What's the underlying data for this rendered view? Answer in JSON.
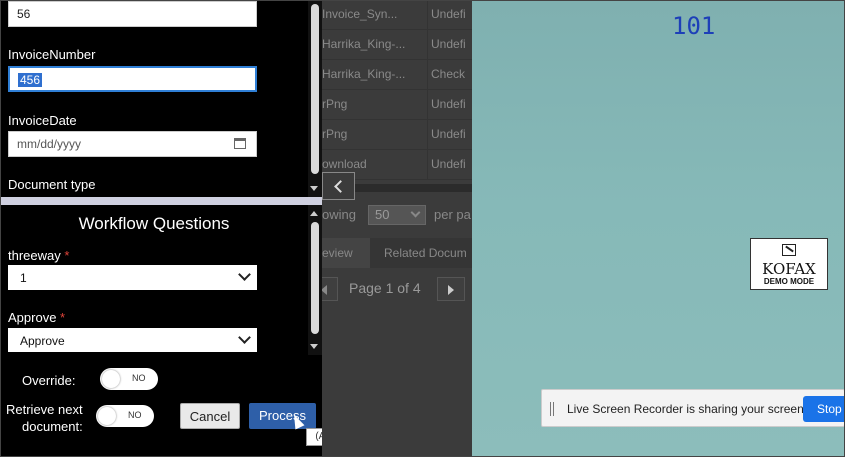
{
  "form": {
    "top_field_value": "56",
    "invoice_number_label": "InvoiceNumber",
    "invoice_number_value": "456",
    "invoice_date_label": "InvoiceDate",
    "invoice_date_placeholder": "mm/dd/yyyy",
    "document_type_label": "Document type"
  },
  "workflow": {
    "title": "Workflow Questions",
    "threeway_label": "threeway",
    "threeway_value": "1",
    "approve_label": "Approve",
    "approve_value": "Approve",
    "required_mark": "*"
  },
  "actions": {
    "override_label": "Override:",
    "override_toggle": "NO",
    "retrieve_label_line1": "Retrieve next",
    "retrieve_label_line2": "document:",
    "retrieve_toggle": "NO",
    "cancel_label": "Cancel",
    "process_label": "Process",
    "process_tooltip": "(Alt + p)"
  },
  "document_list": {
    "rows": [
      {
        "name": "Invoice_Syn...",
        "status": "Undefi"
      },
      {
        "name": "Harrika_King-...",
        "status": "Undefi"
      },
      {
        "name": "Harrika_King-...",
        "status": "Check"
      },
      {
        "name": "rPng",
        "status": "Undefi"
      },
      {
        "name": "rPng",
        "status": "Undefi"
      },
      {
        "name": "ownload",
        "status": "Undefi"
      }
    ],
    "showing_label": "owing",
    "page_size": "50",
    "per_page_label": "per pa",
    "tab_review": "eview",
    "tab_related": "Related Docum",
    "pagination": "Page 1 of 4"
  },
  "preview": {
    "doc_number": "101",
    "watermark_name": "KOFAX",
    "watermark_mode": "DEMO MODE"
  },
  "screen_share": {
    "message": "Live Screen Recorder is sharing your screen.",
    "stop_label": "Stop"
  },
  "colors": {
    "accent": "#2f7fd6",
    "process_button": "#2e5fa8",
    "required": "#e0443a",
    "preview_bg": "#86b9b8",
    "doc_number": "#1d3fb8",
    "stop_button": "#1a73e8"
  }
}
